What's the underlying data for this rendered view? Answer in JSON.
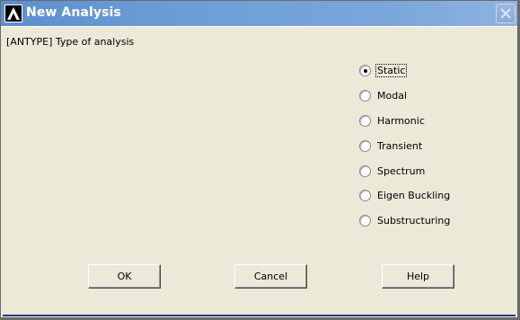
{
  "window": {
    "title": "New Analysis",
    "close_icon": "close-x-icon",
    "app_icon": "ansys-logo-icon"
  },
  "prompt": {
    "label": "[ANTYPE]  Type of analysis"
  },
  "analysis_types": {
    "selected": "Static",
    "options": [
      {
        "label": "Static"
      },
      {
        "label": "Modal"
      },
      {
        "label": "Harmonic"
      },
      {
        "label": "Transient"
      },
      {
        "label": "Spectrum"
      },
      {
        "label": "Eigen Buckling"
      },
      {
        "label": "Substructuring"
      }
    ]
  },
  "buttons": {
    "ok_label": "OK",
    "cancel_label": "Cancel",
    "help_label": "Help"
  },
  "colors": {
    "titlebar": "#6f9fd8",
    "dialog_bg": "#ece9d8"
  }
}
